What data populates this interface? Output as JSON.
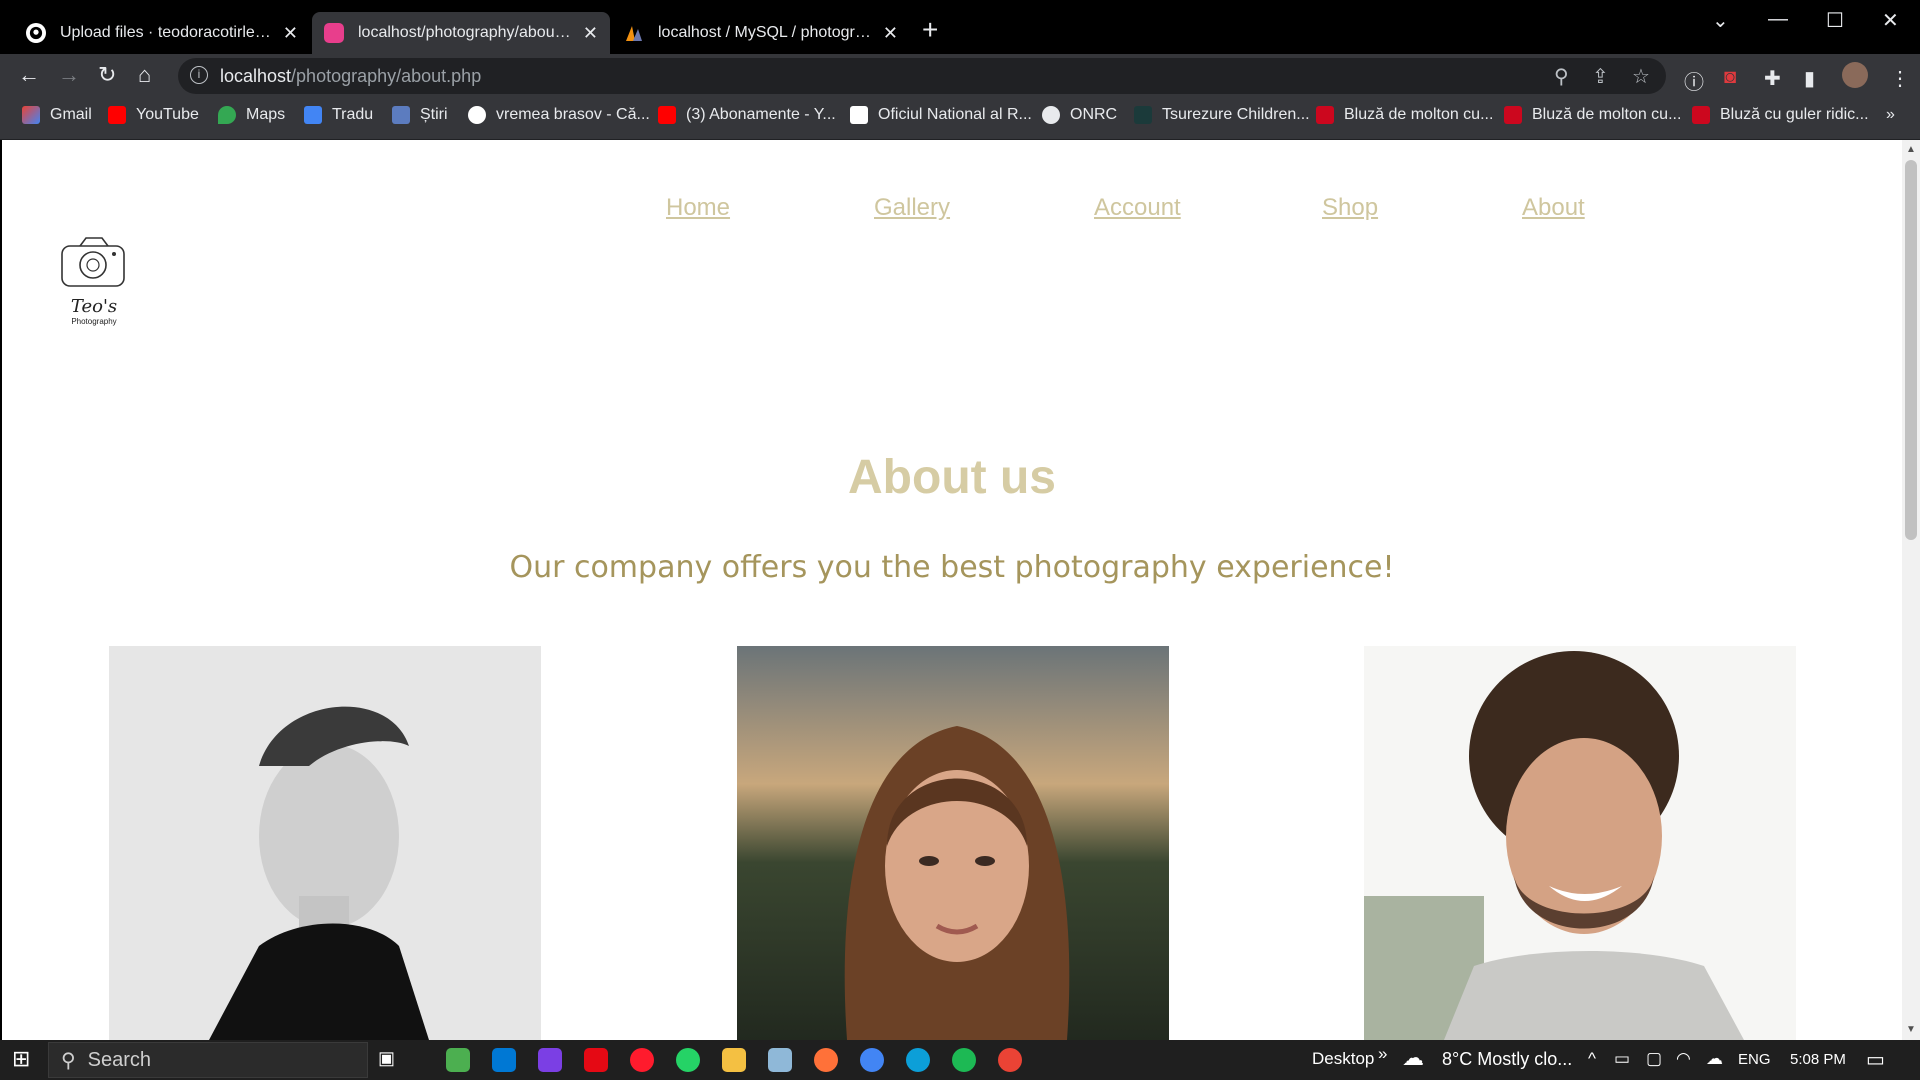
{
  "browser": {
    "tabs": [
      {
        "title": "Upload files · teodoracotirlet/wel",
        "active": false
      },
      {
        "title": "localhost/photography/about.php",
        "active": true
      },
      {
        "title": "localhost / MySQL / photography",
        "active": false
      }
    ],
    "url_host": "localhost",
    "url_path": "/photography/about.php",
    "bookmarks": [
      "Gmail",
      "YouTube",
      "Maps",
      "Tradu",
      "Știri",
      "vremea brasov - Că...",
      "(3) Abonamente - Y...",
      "Oficiul National al R...",
      "ONRC",
      "Tsurezure Children...",
      "Bluză de molton cu...",
      "Bluză de molton cu...",
      "Bluză cu guler ridic..."
    ],
    "more_bookmarks": "»"
  },
  "site": {
    "nav": [
      "Home",
      "Gallery",
      "Account",
      "Shop",
      "About"
    ],
    "logo": {
      "name": "Teo's",
      "tagline": "Photography"
    },
    "title": "About us",
    "subtitle": "Our company offers you the best photography experience!"
  },
  "taskbar": {
    "search_placeholder": "Search",
    "desktop_label": "Desktop",
    "chevron": "»",
    "weather": "8°C  Mostly clo...",
    "language": "ENG",
    "time": "5:08 PM"
  },
  "colors": {
    "accent": "#cfc69e",
    "title": "#d6cca4",
    "subtitle": "#a5955c"
  }
}
